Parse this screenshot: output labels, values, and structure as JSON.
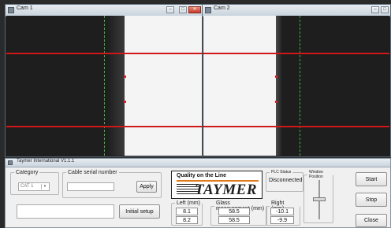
{
  "cam1": {
    "title": "Cam 1"
  },
  "cam2": {
    "title": "Cam 2"
  },
  "control": {
    "title": "Taymer International V1.1.1",
    "category": {
      "label": "Category",
      "value": "CAT 1"
    },
    "cable_serial": {
      "label": "Cable serial number",
      "apply_label": "Apply",
      "value": ""
    },
    "status_text": "",
    "initial_setup_label": "Initial setup",
    "logo": {
      "tagline": "Quality on the Line",
      "brand": "TAYMER"
    },
    "plc_status": {
      "label": "PLC Status",
      "value": "Disconnected"
    },
    "window_position": {
      "label": "Window Position"
    },
    "left": {
      "label": "Left (mm)",
      "values": [
        "8.1",
        "8.2"
      ]
    },
    "glass": {
      "label": "Glass measurement (mm)",
      "values": [
        "58.5",
        "58.5"
      ]
    },
    "right": {
      "label": "Right (mm)",
      "values": [
        "-10.1",
        "-9.9"
      ]
    },
    "buttons": {
      "start": "Start",
      "stop": "Stop",
      "close": "Close"
    }
  },
  "colors": {
    "line_red": "#d01818",
    "guide_green": "#3fae3f",
    "accent_orange": "#e07a1a"
  }
}
